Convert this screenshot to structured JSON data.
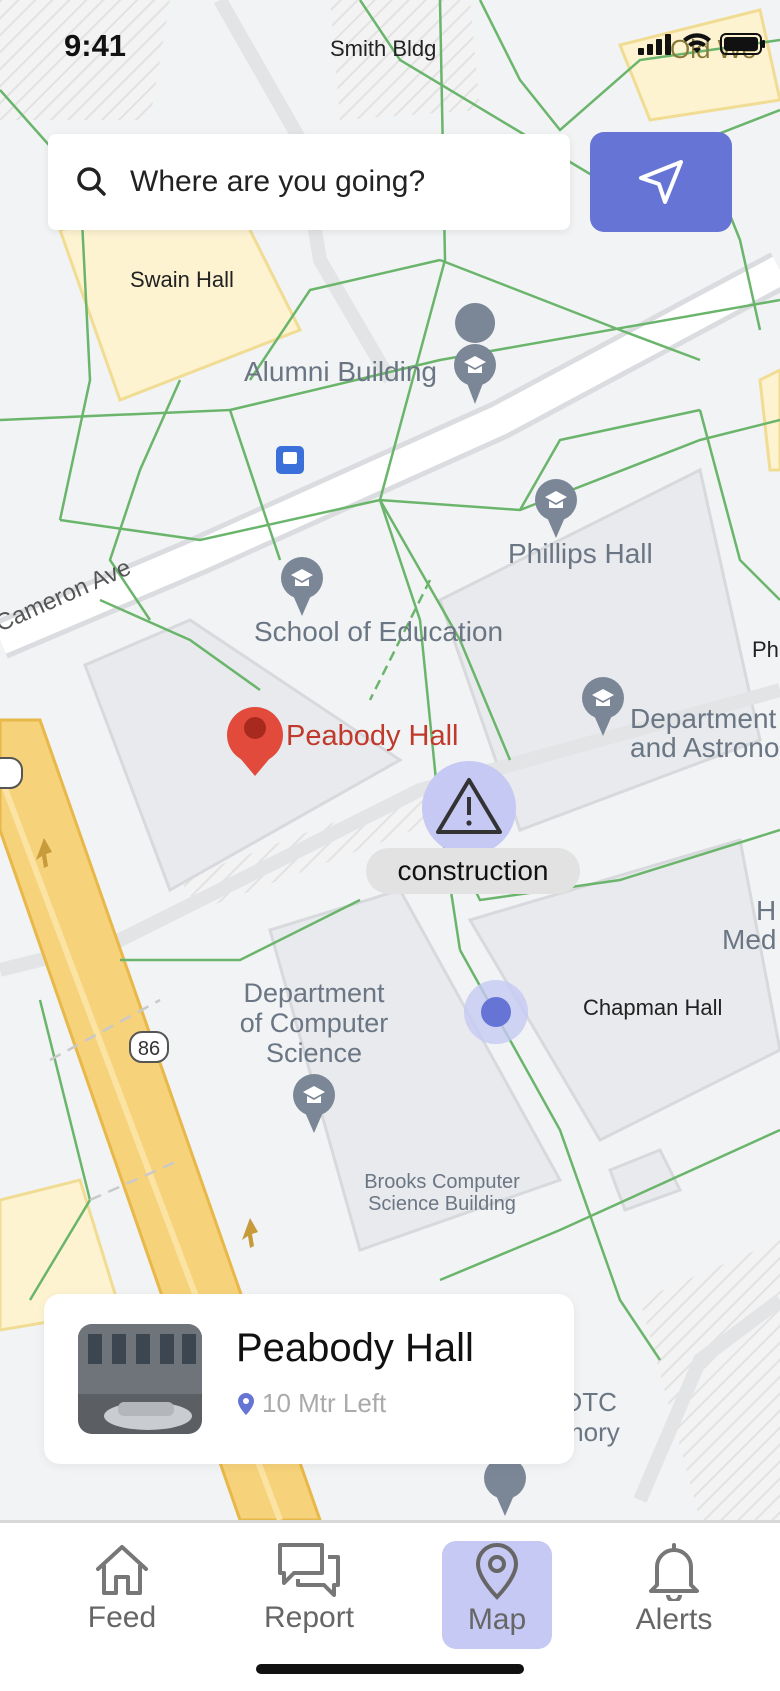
{
  "status": {
    "time": "9:41",
    "location": "Smith Bldg"
  },
  "search": {
    "placeholder": "Where are you going?"
  },
  "map": {
    "streets": {
      "cameron": "Cameron Ave",
      "route86": "86"
    },
    "labels": {
      "swain": "Swain Hall",
      "alumni": "Alumni Building",
      "phillips": "Phillips Hall",
      "education": "School of Education",
      "peabody": "Peabody Hall",
      "astro1": "Department",
      "astro2": "and Astrono",
      "ph": "Ph",
      "hmed1": "H",
      "hmed2": "Med",
      "chapman": "Chapman Hall",
      "cs1": "Department",
      "cs2": "of Computer",
      "cs3": "Science",
      "brooks1": "Brooks Computer",
      "brooks2": "Science Building",
      "otc1": "OTC",
      "otc2": "mory",
      "oldwest": "Old We"
    },
    "hazard": {
      "label": "construction"
    }
  },
  "card": {
    "title": "Peabody Hall",
    "distance": "10 Mtr Left"
  },
  "tabs": [
    {
      "label": "Feed",
      "icon": "home-icon"
    },
    {
      "label": "Report",
      "icon": "chat-icon"
    },
    {
      "label": "Map",
      "icon": "location-pin-icon",
      "active": true
    },
    {
      "label": "Alerts",
      "icon": "bell-icon"
    }
  ],
  "colors": {
    "accent": "#6674d6",
    "accent_light": "#c5c9f3",
    "paths": "#6ab56b",
    "road": "#f6d27a",
    "marker": "#e24a3b"
  }
}
